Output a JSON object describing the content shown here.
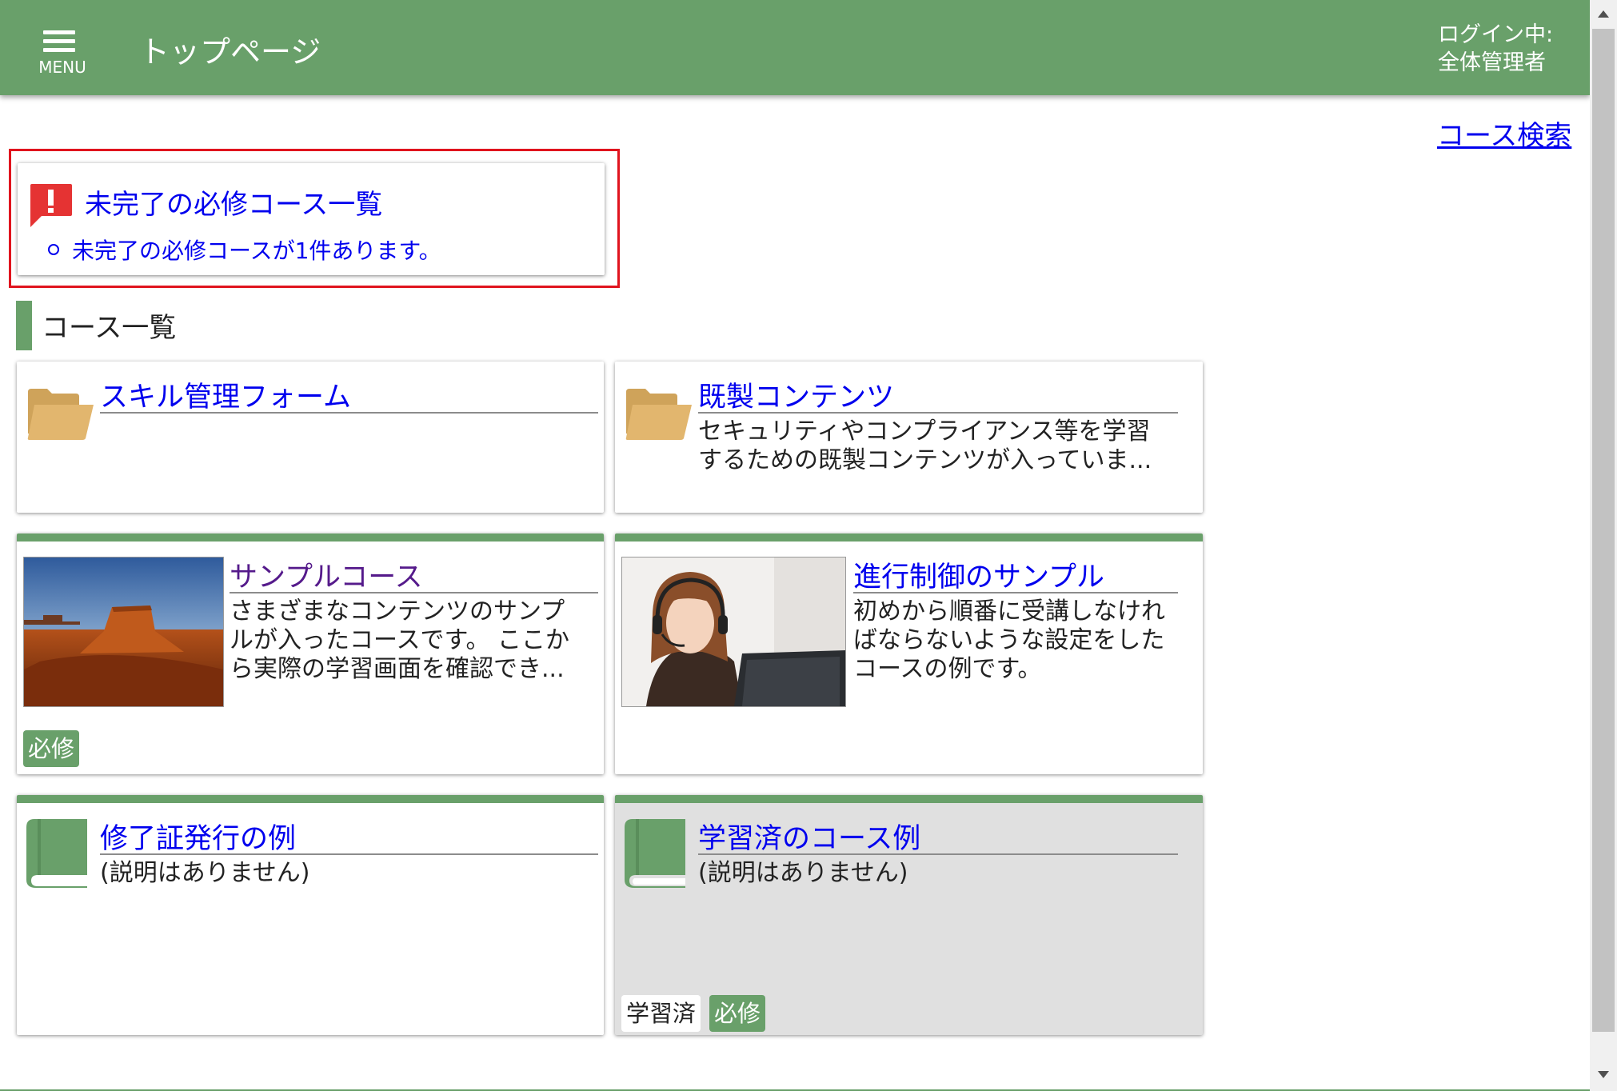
{
  "header": {
    "menu_label": "MENU",
    "page_title": "トップページ",
    "login_line1": "ログイン中:",
    "login_line2": "全体管理者",
    "color": "#69a06a"
  },
  "search_link": "コース検索",
  "alert": {
    "title": "未完了の必修コース一覧",
    "message": "未完了の必修コースが1件あります。",
    "icon": "exclamation-speech-bubble-icon",
    "color": "#e53333"
  },
  "section_title": "コース一覧",
  "cards": [
    {
      "type": "folder",
      "title": "スキル管理フォーム",
      "description": "",
      "icon": "folder-icon"
    },
    {
      "type": "folder",
      "title": "既製コンテンツ",
      "description_line1": "セキュリティやコンプライアンス等を学習",
      "description_line2": "するための既製コンテンツが入っていま...",
      "icon": "folder-icon"
    },
    {
      "type": "course",
      "title": "サンプルコース",
      "description_line1": "さまざまなコンテンツのサンプ",
      "description_line2": "ルが入ったコースです。 ここか",
      "description_line3": "ら実際の学習画面を確認でき...",
      "image": "desert-mesa-photo",
      "badge": "必修"
    },
    {
      "type": "course",
      "title": "進行制御のサンプル",
      "description_line1": "初めから順番に受講しなけれ",
      "description_line2": "ばならないような設定をした",
      "description_line3": "コースの例です。",
      "image": "woman-with-headset-photo"
    },
    {
      "type": "course",
      "title": "修了証発行の例",
      "description": "(説明はありません)",
      "icon": "book-icon"
    },
    {
      "type": "course",
      "title": "学習済のコース例",
      "description": "(説明はありません)",
      "icon": "book-icon",
      "badge_done": "学習済",
      "badge": "必修"
    }
  ],
  "colors": {
    "link": "#0000ee",
    "visited": "#551a8b",
    "highlight": "#e0141e",
    "folder": "#e2b66e",
    "book": "#69a06a"
  }
}
